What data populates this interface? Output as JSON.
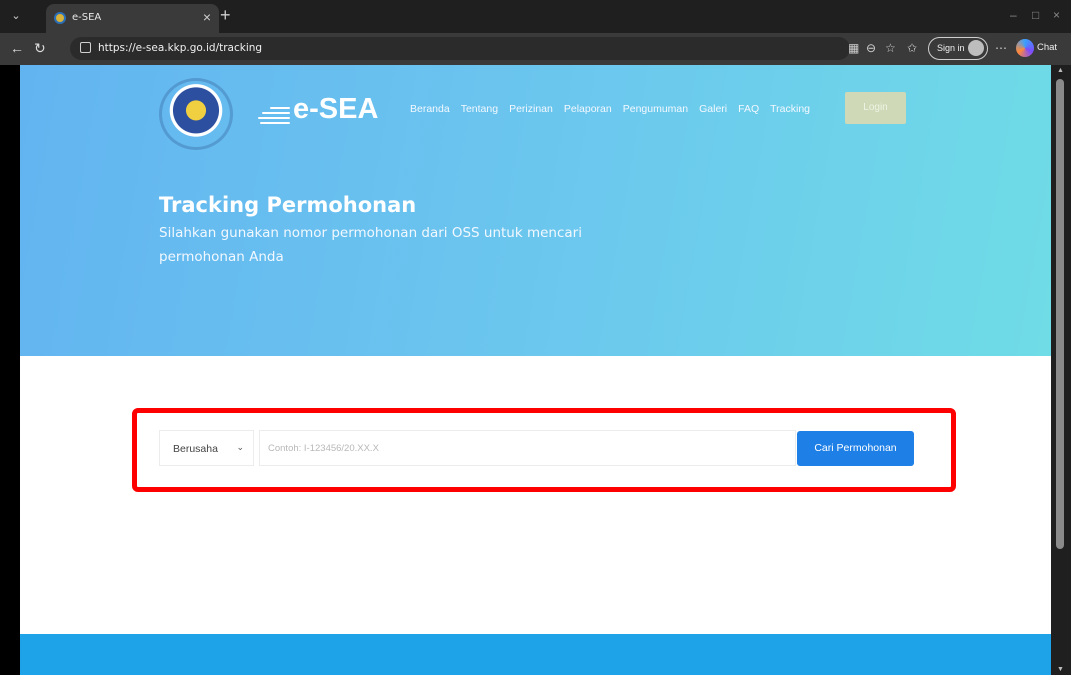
{
  "browser": {
    "tab_title": "e-SEA",
    "url": "https://e-sea.kkp.go.id/tracking",
    "sign_in_label": "Sign in",
    "chat_label": "Chat"
  },
  "header": {
    "logo_text": "e-SEA",
    "nav_items": [
      "Beranda",
      "Tentang",
      "Perizinan",
      "Pelaporan",
      "Pengumuman",
      "Galeri",
      "FAQ",
      "Tracking"
    ],
    "login_label": "Login"
  },
  "hero": {
    "title": "Tracking Permohonan",
    "subtitle": "Silahkan gunakan nomor permohonan dari OSS untuk mencari permohonan Anda"
  },
  "search": {
    "category_value": "Berusaha",
    "query_placeholder": "Contoh: I-123456/20.XX.X",
    "button_label": "Cari Permohonan"
  },
  "colors": {
    "hero_start": "#62b4f0",
    "hero_end": "#6fdce6",
    "button_blue": "#1e7fe6",
    "highlight_red": "#ff0000",
    "footer_blue": "#1ea3e8"
  }
}
